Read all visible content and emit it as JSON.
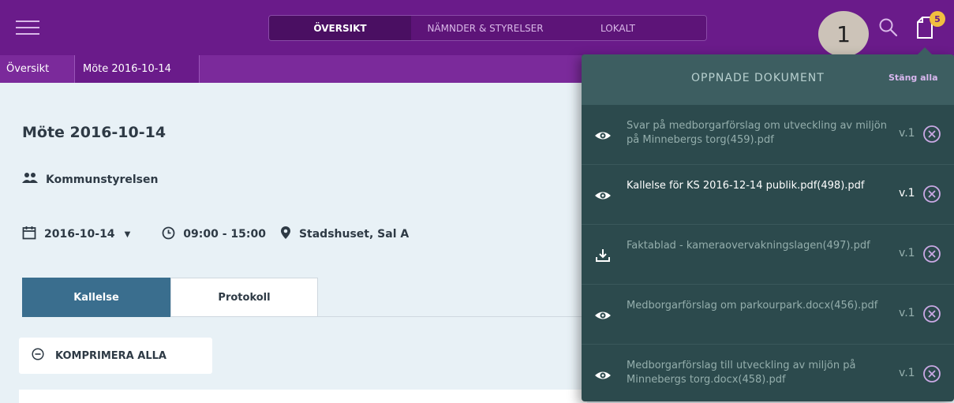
{
  "nav": {
    "tabs": [
      {
        "label": "ÖVERSIKT"
      },
      {
        "label": "NÄMNDER & STYRELSER"
      },
      {
        "label": "LOKALT"
      }
    ],
    "step_marker": "1",
    "open_docs_count": "5"
  },
  "breadcrumb": [
    {
      "label": "Översikt"
    },
    {
      "label": "Möte 2016-10-14"
    }
  ],
  "meeting": {
    "title": "Möte 2016-10-14",
    "committee": "Kommunstyrelsen",
    "date": "2016-10-14",
    "time": "09:00 - 15:00",
    "location": "Stadshuset, Sal A"
  },
  "doc_tabs": [
    {
      "label": "Kallelse"
    },
    {
      "label": "Protokoll"
    }
  ],
  "collapse_all_label": "KOMPRIMERA ALLA",
  "open_documents": {
    "title": "OPPNADE DOKUMENT",
    "close_all": "Stäng alla",
    "items": [
      {
        "name": "Svar på medborgarförslag om utveckling av miljön på Minnebergs torg(459).pdf",
        "version": "v.1",
        "icon": "eye-icon"
      },
      {
        "name": "Kallelse för KS 2016-12-14 publik.pdf(498).pdf",
        "version": "v.1",
        "icon": "eye-icon"
      },
      {
        "name": "Faktablad - kameraovervakningslagen(497).pdf",
        "version": "v.1",
        "icon": "download-icon"
      },
      {
        "name": "Medborgarförslag om parkourpark.docx(456).pdf",
        "version": "v.1",
        "icon": "eye-icon"
      },
      {
        "name": "Medborgarförslag till utveckling av miljön på Minnebergs torg.docx(458).pdf",
        "version": "v.1",
        "icon": "eye-icon"
      }
    ]
  },
  "colors": {
    "header": "#6a1b8a",
    "panel": "#2c4a4d",
    "active_tab": "#3a6e8e",
    "badge": "#f1bf3f"
  }
}
